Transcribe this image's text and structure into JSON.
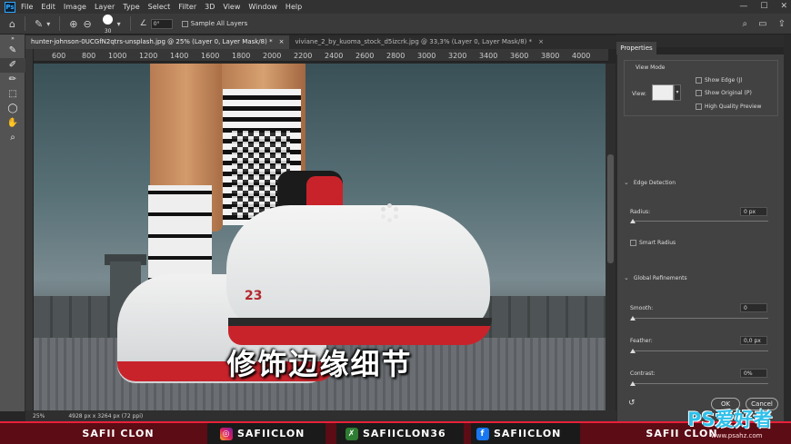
{
  "app": {
    "logo": "Ps"
  },
  "menu": [
    "File",
    "Edit",
    "Image",
    "Layer",
    "Type",
    "Select",
    "Filter",
    "3D",
    "View",
    "Window",
    "Help"
  ],
  "window_controls": [
    "—",
    "☐",
    "✕"
  ],
  "options": {
    "brush_size": "30",
    "angle": "0°",
    "sample_all_layers": "Sample All Layers"
  },
  "tabs": [
    {
      "label": "hunter-johnson-0UCGfN2qtrs-unsplash.jpg @ 25% (Layer 0, Layer Mask/8) *",
      "close": "×"
    },
    {
      "label": "viviane_2_by_kuoma_stock_d5izcrk.jpg @ 33,3% (Layer 0, Layer Mask/8) *",
      "close": "×"
    }
  ],
  "ruler": [
    "600",
    "800",
    "1000",
    "1200",
    "1400",
    "1600",
    "1800",
    "2000",
    "2200",
    "2400",
    "2600",
    "2800",
    "3000",
    "3200",
    "3400",
    "3600",
    "3800",
    "4000"
  ],
  "canvas": {
    "subtitle": "修饰边缘细节",
    "shoe_number": "23"
  },
  "status": {
    "zoom": "25%",
    "doc_info": "4928 px x 3264 px (72 ppi)"
  },
  "properties": {
    "tab": "Properties",
    "view_mode": "View Mode",
    "view_label": "View:",
    "show_edge": "Show Edge (J)",
    "show_original": "Show Original (P)",
    "high_quality": "High Quality Preview",
    "edge_detection": "Edge Detection",
    "radius_label": "Radius:",
    "radius_value": "0 px",
    "smart_radius": "Smart Radius",
    "global_refinements": "Global Refinements",
    "smooth_label": "Smooth:",
    "smooth_value": "0",
    "feather_label": "Feather:",
    "feather_value": "0,0 px",
    "contrast_label": "Contrast:",
    "contrast_value": "0%",
    "ok": "OK",
    "cancel": "Cancel"
  },
  "banner": {
    "left_name": "SAFII CLON",
    "instagram": "SAFIICLON",
    "other": "SAFIICLON36",
    "facebook": "SAFIICLON",
    "right_name": "SAFII CLON"
  },
  "watermark": {
    "main": "PS爱好者",
    "sub": "www.psahz.com"
  },
  "colors": {
    "accent": "#31a8ff",
    "banner_red": "#e8213a",
    "sole_red": "#c8232b"
  }
}
